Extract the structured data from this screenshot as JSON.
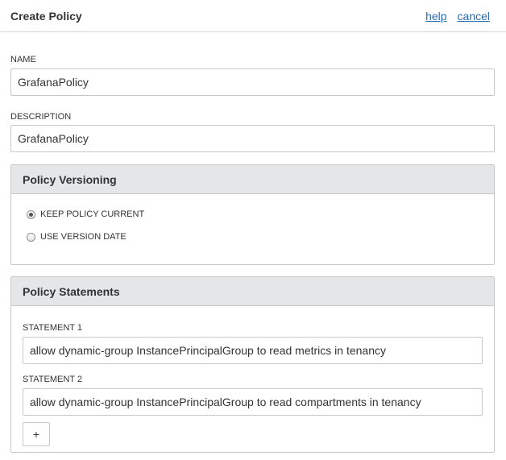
{
  "header": {
    "title": "Create Policy",
    "help_label": "help",
    "cancel_label": "cancel"
  },
  "name_field": {
    "label": "NAME",
    "value": "GrafanaPolicy"
  },
  "description_field": {
    "label": "DESCRIPTION",
    "value": "GrafanaPolicy"
  },
  "versioning": {
    "title": "Policy Versioning",
    "options": [
      {
        "label": "KEEP POLICY CURRENT",
        "selected": true
      },
      {
        "label": "USE VERSION DATE",
        "selected": false
      }
    ]
  },
  "statements": {
    "title": "Policy Statements",
    "items": [
      {
        "label": "STATEMENT 1",
        "value": "allow dynamic-group InstancePrincipalGroup to read metrics in tenancy"
      },
      {
        "label": "STATEMENT 2",
        "value": "allow dynamic-group InstancePrincipalGroup to read compartments in tenancy"
      }
    ],
    "add_label": "+"
  }
}
